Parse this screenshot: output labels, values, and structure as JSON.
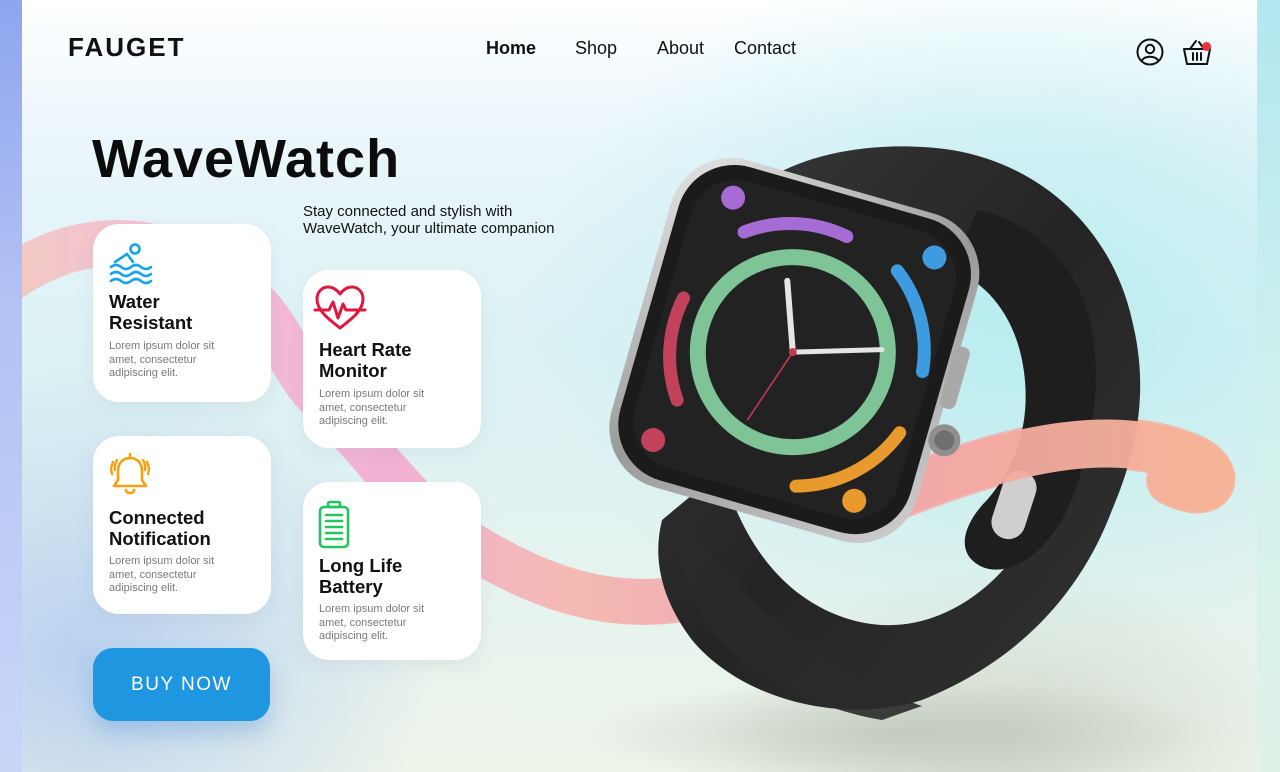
{
  "brand": {
    "name": "FAUGET"
  },
  "nav": {
    "items": [
      {
        "label": "Home",
        "active": true
      },
      {
        "label": "Shop",
        "active": false
      },
      {
        "label": "About",
        "active": false
      },
      {
        "label": "Contact",
        "active": false
      }
    ],
    "icons": [
      "user-icon",
      "basket-icon"
    ]
  },
  "hero": {
    "title": "WaveWatch",
    "tagline_line1": "Stay connected and stylish with",
    "tagline_line2": "WaveWatch, your ultimate companion"
  },
  "features": [
    {
      "icon": "swimmer-icon",
      "title_line1": "Water",
      "title_line2": "Resistant",
      "desc_line1": "Lorem ipsum dolor sit",
      "desc_line2": "amet, consectetur",
      "desc_line3": "adipiscing elit.",
      "color": "#16a3ea"
    },
    {
      "icon": "heart-rate-icon",
      "title_line1": "Heart Rate",
      "title_line2": "Monitor",
      "desc_line1": "Lorem ipsum dolor sit",
      "desc_line2": "amet, consectetur",
      "desc_line3": "adipiscing elit.",
      "color": "#e0173e"
    },
    {
      "icon": "bell-icon",
      "title_line1": "Connected",
      "title_line2": "Notification",
      "desc_line1": "Lorem ipsum dolor sit",
      "desc_line2": "amet, consectetur",
      "desc_line3": "adipiscing elit.",
      "color": "#f5a10f"
    },
    {
      "icon": "battery-icon",
      "title_line1": "Long Life",
      "title_line2": "Battery",
      "desc_line1": "Lorem ipsum dolor sit",
      "desc_line2": "amet, consectetur",
      "desc_line3": "adipiscing elit.",
      "color": "#22c55e"
    }
  ],
  "cta": {
    "label": "BUY NOW",
    "color": "#1f96e0"
  },
  "colors": {
    "ribbon_pink": "#f7a6c9",
    "ribbon_peach": "#f6b39a",
    "watch_body": "#2b2b2b"
  }
}
